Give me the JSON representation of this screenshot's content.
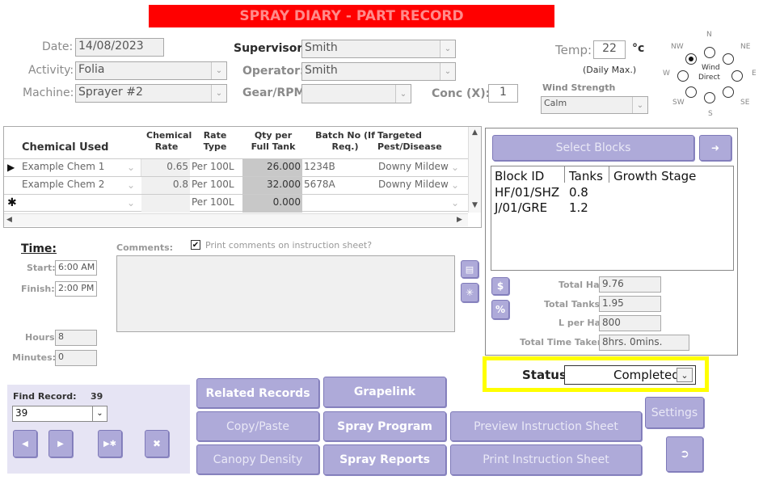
{
  "title": "SPRAY DIARY - PART RECORD",
  "header": {
    "date_label": "Date:",
    "date_value": "14/08/2023",
    "activity_label": "Activity:",
    "activity_value": "Folia",
    "machine_label": "Machine:",
    "machine_value": "Sprayer #2",
    "supervisor_label": "Supervisor:",
    "supervisor_value": "Smith",
    "operator_label": "Operator:",
    "operator_value": "Smith",
    "gear_label": "Gear/RPM",
    "gear_value": "",
    "conc_label": "Conc (X):",
    "conc_value": "1",
    "temp_label": "Temp:",
    "temp_value": "22",
    "temp_unit": "°c",
    "temp_note": "(Daily Max.)",
    "wind_strength_label": "Wind Strength",
    "wind_strength_value": "Calm"
  },
  "wind": {
    "N": "N",
    "NE": "NE",
    "E": "E",
    "SE": "SE",
    "S": "S",
    "SW": "SW",
    "W": "W",
    "NW": "NW",
    "center_line1": "Wind",
    "center_line2": "Direct",
    "selected": "NW"
  },
  "chem_table": {
    "headers": [
      "Chemical Used",
      "Chemical Rate",
      "Rate Type",
      "Qty per Full Tank",
      "Batch No (If Req.)",
      "Targeted Pest/Disease"
    ],
    "rows": [
      {
        "chemical": "Example Chem 1",
        "rate": "0.65",
        "rate_type": "Per 100L",
        "qty": "26.000",
        "batch": "1234B",
        "target": "Downy Mildew"
      },
      {
        "chemical": "Example Chem 2",
        "rate": "0.8",
        "rate_type": "Per 100L",
        "qty": "32.000",
        "batch": "5678A",
        "target": "Downy Mildew"
      },
      {
        "chemical": "",
        "rate": "",
        "rate_type": "Per 100L",
        "qty": "0.000",
        "batch": "",
        "target": ""
      }
    ]
  },
  "time": {
    "title": "Time:",
    "start_label": "Start:",
    "start_value": "6:00 AM",
    "finish_label": "Finish:",
    "finish_value": "2:00 PM",
    "hours_label": "Hours:",
    "hours_value": "8",
    "minutes_label": "Minutes:",
    "minutes_value": "0"
  },
  "comments": {
    "label": "Comments:",
    "print_label": "Print comments on instruction sheet?",
    "print_checked": true,
    "value": ""
  },
  "blocks": {
    "select_label": "Select Blocks",
    "headers": [
      "Block ID",
      "Tanks",
      "Growth Stage"
    ],
    "rows": [
      {
        "id": "HF/01/SHZ",
        "tanks": "0.8",
        "stage": ""
      },
      {
        "id": "J/01/GRE",
        "tanks": "1.2",
        "stage": ""
      }
    ],
    "total_ha_label": "Total Ha:",
    "total_ha_value": "9.76",
    "total_tanks_label": "Total Tanks:",
    "total_tanks_value": "1.95",
    "l_per_ha_label": "L per Ha:",
    "l_per_ha_value": "800",
    "total_time_label": "Total Time Taken:",
    "total_time_value": "8hrs. 0mins."
  },
  "status": {
    "label": "Status:",
    "value": "Completed",
    "highlight_color": "#ffff00"
  },
  "find": {
    "label": "Find Record:",
    "count": "39",
    "value": "39"
  },
  "buttons": {
    "related": "Related Records",
    "grapelink": "Grapelink",
    "copy_paste": "Copy/Paste",
    "spray_program": "Spray Program",
    "preview_sheet": "Preview Instruction Sheet",
    "settings": "Settings",
    "canopy": "Canopy Density",
    "spray_reports": "Spray Reports",
    "print_sheet": "Print Instruction Sheet"
  },
  "colors": {
    "title_bg": "#ff0000",
    "title_fg": "#ff8080",
    "button_bg": "#aeaad9",
    "status_highlight": "#ffff00"
  }
}
